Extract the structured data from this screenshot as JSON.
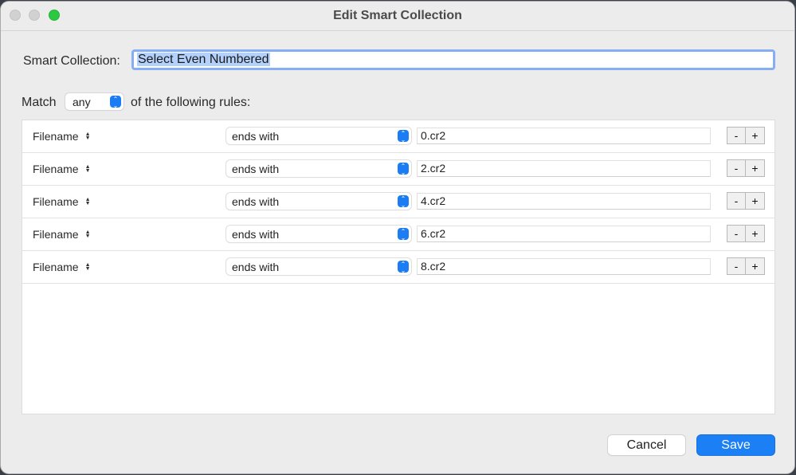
{
  "window": {
    "title": "Edit Smart Collection",
    "traffic_lights": [
      "close",
      "minimize",
      "zoom"
    ]
  },
  "name": {
    "label": "Smart Collection:",
    "value": "Select Even Numbered"
  },
  "match": {
    "label": "Match",
    "value": "any",
    "tail": "of the following rules:"
  },
  "rules": [
    {
      "field": "Filename",
      "operator": "ends with",
      "value": "0.cr2"
    },
    {
      "field": "Filename",
      "operator": "ends with",
      "value": "2.cr2"
    },
    {
      "field": "Filename",
      "operator": "ends with",
      "value": "4.cr2"
    },
    {
      "field": "Filename",
      "operator": "ends with",
      "value": "6.cr2"
    },
    {
      "field": "Filename",
      "operator": "ends with",
      "value": "8.cr2"
    }
  ],
  "rule_buttons": {
    "remove": "-",
    "add": "+"
  },
  "icons": {
    "updown": "⬍",
    "field_arrows": "⬍"
  },
  "footer": {
    "cancel": "Cancel",
    "save": "Save"
  },
  "colors": {
    "accent": "#1b7ff5",
    "zoom_green": "#2bc840",
    "focus_ring": "#85aef5",
    "selection": "#b3d1fb"
  }
}
